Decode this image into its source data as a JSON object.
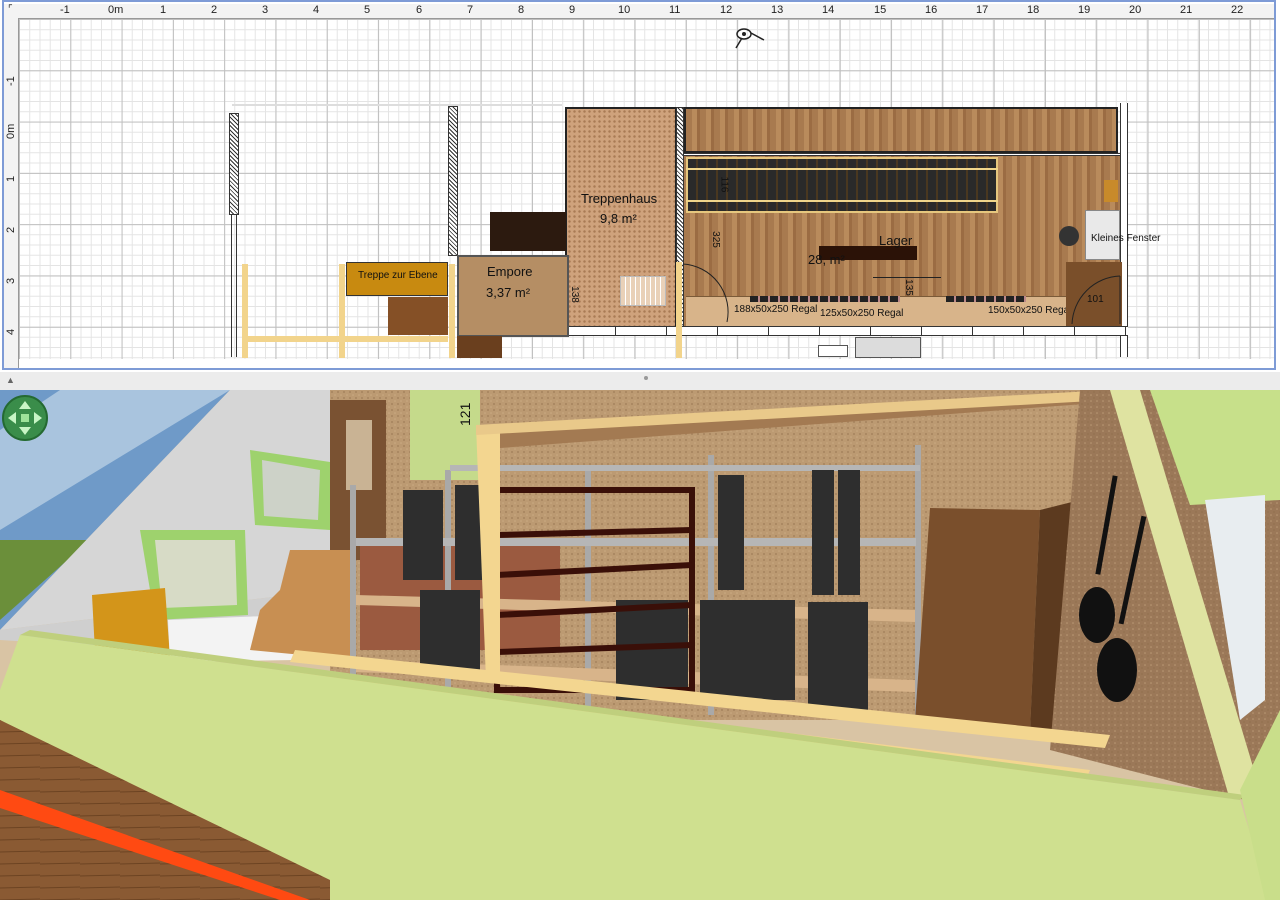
{
  "ruler": {
    "top_labels": [
      "-1",
      "0m",
      "1",
      "2",
      "3",
      "4",
      "5",
      "6",
      "7",
      "8",
      "9",
      "10",
      "11",
      "12",
      "13",
      "14",
      "15",
      "16",
      "17",
      "18",
      "19",
      "20",
      "21",
      "22"
    ],
    "left_labels": [
      "-1",
      "0m",
      "1",
      "2",
      "3",
      "4"
    ]
  },
  "plan": {
    "rooms": [
      {
        "name": "Treppenhaus",
        "area": "9,8 m²"
      },
      {
        "name": "Empore",
        "area": "3,37 m²"
      },
      {
        "name": "Lager",
        "area": "28,  m²"
      }
    ],
    "furniture_labels": {
      "stairs": "Treppe zur Ebene",
      "shelf_1": "188x50x250 Regal",
      "shelf_2": "125x50x250 Regal",
      "shelf_3": "150x50x250 Regal",
      "window": "Kleines Fenster"
    },
    "dimensions": {
      "d116": "116",
      "d325": "325",
      "d138": "138",
      "d135": "135",
      "d101": "101"
    }
  },
  "view3d": {
    "dimension_label": "121",
    "navigation": "navigation-arrows-icon"
  },
  "colors": {
    "plan_border": "#7e9bd6",
    "wall_green": "#cfe08f",
    "floor_wood": "#8a5a33",
    "highlight_orange": "#ff4a12"
  }
}
